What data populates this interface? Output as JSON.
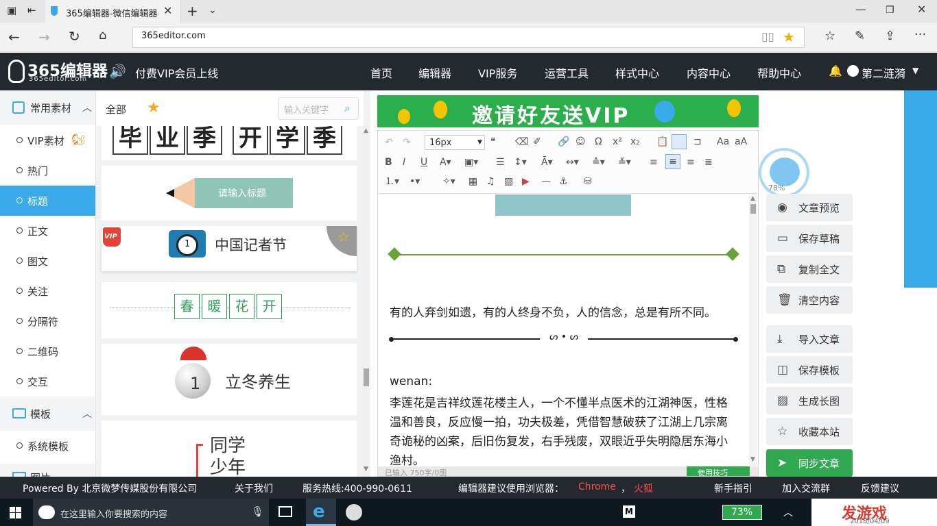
{
  "browser": {
    "tab_title": "365编辑器-微信编辑器-",
    "url": "365editor.com"
  },
  "header": {
    "logo_text": "365编辑器",
    "logo_sub": "365editor.com",
    "promo": "付费VIP会员上线",
    "nav": [
      "首页",
      "编辑器",
      "VIP服务",
      "运营工具",
      "样式中心",
      "内容中心",
      "帮助中心"
    ],
    "username": "第二涟漪"
  },
  "categories": {
    "group1": "常用素材",
    "items": [
      "VIP素材",
      "热门",
      "标题",
      "正文",
      "图文",
      "关注",
      "分隔符",
      "二维码",
      "交互"
    ],
    "active": "标题",
    "group2": "模板",
    "group2_items": [
      "系统模板"
    ],
    "group3_partial": "图片"
  },
  "material": {
    "tab_all": "全部",
    "search_placeholder": "输入关键字",
    "card1_chars_a": [
      "毕",
      "业",
      "季"
    ],
    "card1_chars_b": [
      "开",
      "学",
      "季"
    ],
    "card2_title": "请输入标题",
    "card3_vip": "VIP",
    "card3_num": "1",
    "card3_title": "中国记者节",
    "card4_chars": [
      "春",
      "暖",
      "花",
      "开"
    ],
    "card5_num": "1",
    "card5_title": "立冬养生",
    "card6_line1": "同学",
    "card6_line2": "少年"
  },
  "banner": {
    "text": "邀请好友送VIP"
  },
  "editor": {
    "font_size": "16px",
    "paragraph1": "有的人弃剑如遗，有的人终身不负，人的信念，总是有所不同。",
    "label": "wenan:",
    "paragraph2": "李莲花是吉祥纹莲花楼主人，一个不懂半点医术的江湖神医，性格温和善良，反应慢一拍，功夫极差，凭借智慧破获了江湖上几宗离奇诡秘的凶案，后旧伤复发，右手残废，双眼近乎失明隐居东海小渔村。",
    "status_partial": "已输入 750字/0图",
    "sync_partial": "使用技巧"
  },
  "widget": {
    "percent": "78%"
  },
  "actions": [
    "文章预览",
    "保存草稿",
    "复制全文",
    "清空内容",
    "导入文章",
    "保存模板",
    "生成长图",
    "收藏本站",
    "同步文章"
  ],
  "footer": {
    "powered": "Powered By 北京微梦传媒股份有限公司",
    "about": "关于我们",
    "hotline": "服务热线:400-990-0611",
    "browser_hint": "编辑器建议使用浏览器：",
    "chrome": "Chrome",
    "sep": "，",
    "firefox": "火狐",
    "guide": "新手指引",
    "join": "加入交流群",
    "feedback": "反馈建议"
  },
  "taskbar": {
    "search_placeholder": "在这里输入你要搜索的内容",
    "battery": "73%",
    "watermark": "发游戏",
    "date_partial": "2018/04/09"
  },
  "colors": {
    "accent_blue": "#3aa9e8",
    "header_dark": "#24282f",
    "green": "#2fa84f",
    "footer_red": "#ff4d4d"
  }
}
